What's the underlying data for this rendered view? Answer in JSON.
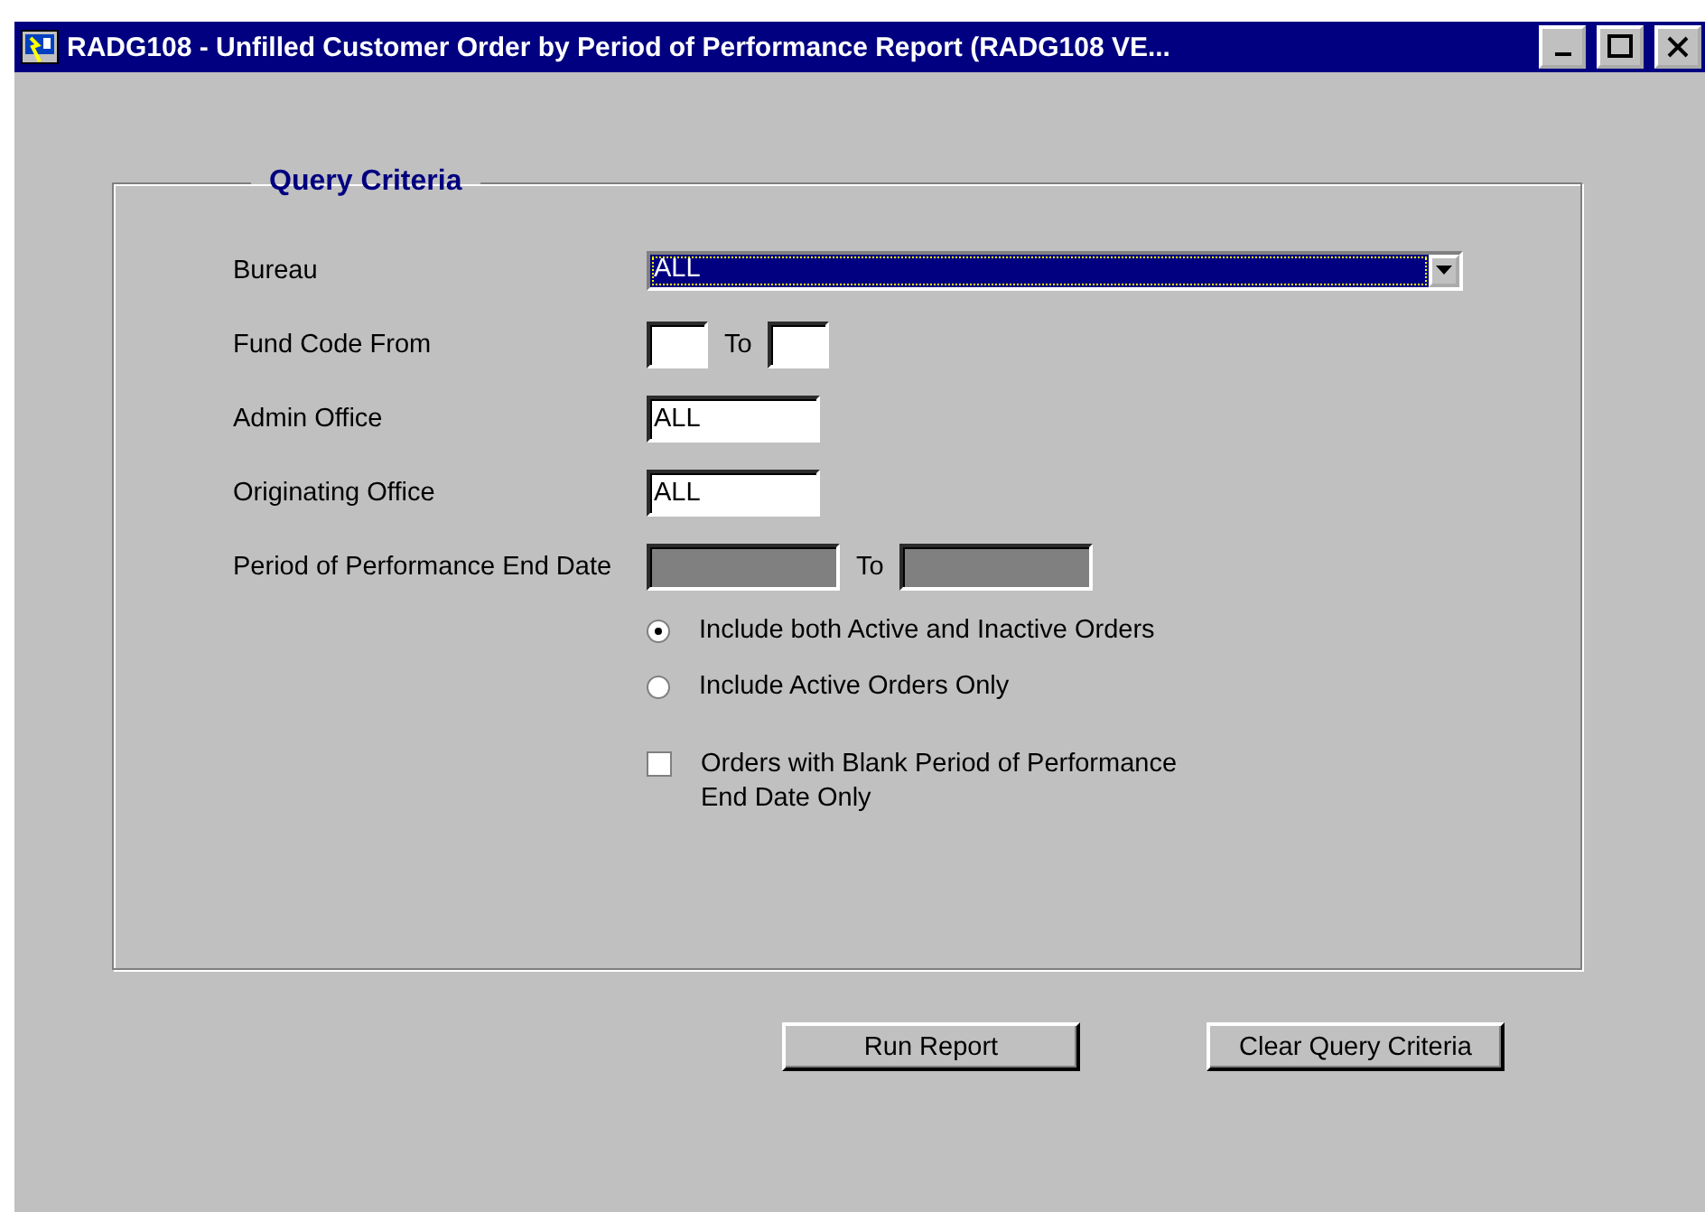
{
  "window": {
    "title": "RADG108 - Unfilled Customer Order by Period of Performance Report (RADG108 VE..."
  },
  "group": {
    "title": "Query Criteria"
  },
  "fields": [
    {
      "kind": "dropdown",
      "label": "Bureau",
      "value": "ALL",
      "focused": true
    },
    {
      "kind": "range",
      "label": "Fund Code From",
      "separator": "To",
      "disabled": false
    },
    {
      "kind": "text",
      "label": "Admin Office",
      "value": "ALL"
    },
    {
      "kind": "text",
      "label": "Originating Office",
      "value": "ALL"
    },
    {
      "kind": "range",
      "label": "Period of Performance End Date",
      "separator": "To",
      "disabled": true
    }
  ],
  "options": [
    {
      "kind": "radio",
      "label": "Include both Active and Inactive Orders",
      "selected": true
    },
    {
      "kind": "radio",
      "label": "Include Active Orders Only",
      "selected": false
    },
    {
      "kind": "checkbox",
      "label": "Orders with Blank Period of Performance\n End Date Only",
      "checked": false
    }
  ],
  "buttons": [
    "Run Report",
    "Clear Query Criteria"
  ]
}
